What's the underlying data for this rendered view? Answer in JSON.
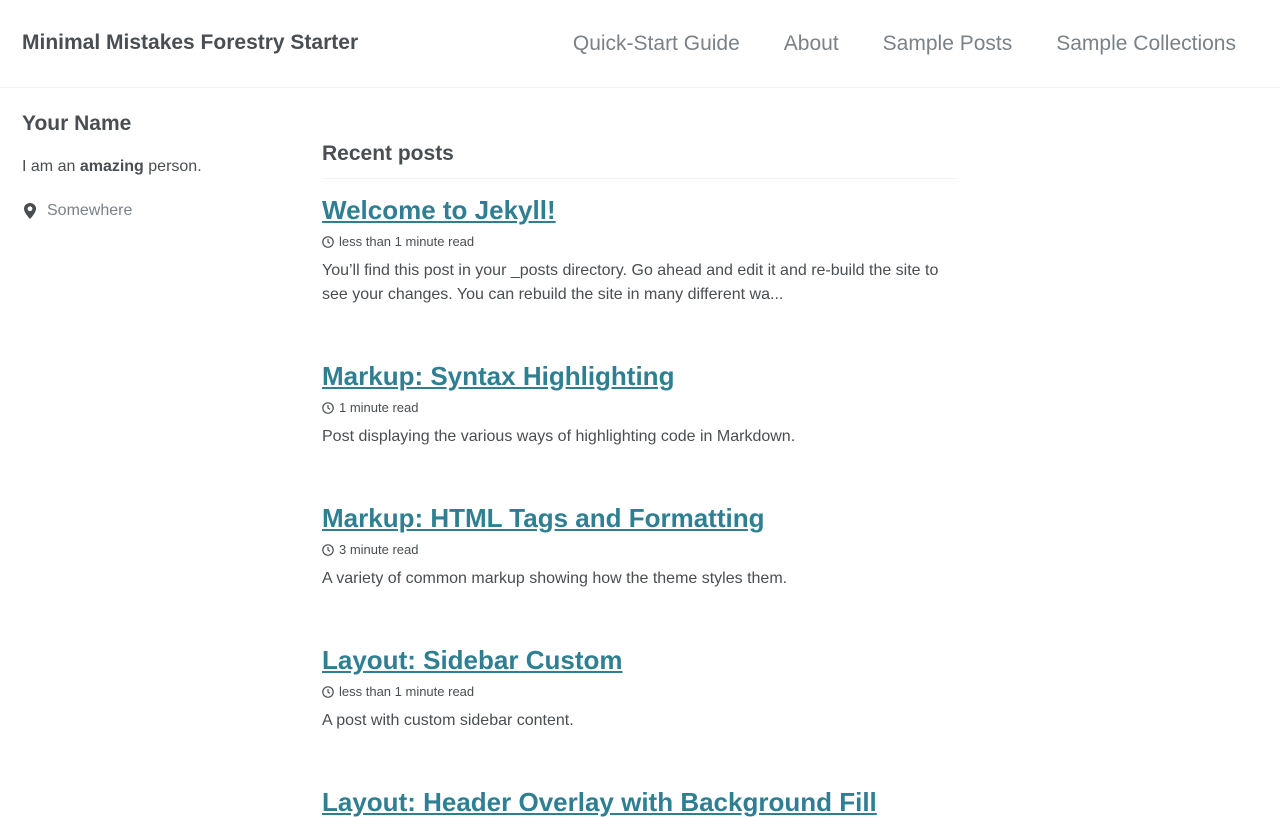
{
  "header": {
    "site_title": "Minimal Mistakes Forestry Starter",
    "nav": [
      {
        "label": "Quick-Start Guide"
      },
      {
        "label": "About"
      },
      {
        "label": "Sample Posts"
      },
      {
        "label": "Sample Collections"
      }
    ]
  },
  "sidebar": {
    "author_name": "Your Name",
    "bio_prefix": "I am an ",
    "bio_strong": "amazing",
    "bio_suffix": " person.",
    "location": "Somewhere",
    "location_icon": "map-marker-icon"
  },
  "main": {
    "section_title": "Recent posts",
    "posts": [
      {
        "title": "Welcome to Jekyll!",
        "read_time": "less than 1 minute read",
        "excerpt": "You’ll find this post in your _posts directory. Go ahead and edit it and re-build the site to see your changes. You can rebuild the site in many different wa..."
      },
      {
        "title": "Markup: Syntax Highlighting",
        "read_time": "1 minute read",
        "excerpt": "Post displaying the various ways of highlighting code in Markdown."
      },
      {
        "title": "Markup: HTML Tags and Formatting",
        "read_time": "3 minute read",
        "excerpt": "A variety of common markup showing how the theme styles them."
      },
      {
        "title": "Layout: Sidebar Custom",
        "read_time": "less than 1 minute read",
        "excerpt": "A post with custom sidebar content."
      },
      {
        "title": "Layout: Header Overlay with Background Fill",
        "read_time": "",
        "excerpt": ""
      }
    ]
  },
  "colors": {
    "link": "#2f7f93",
    "text": "#494e52",
    "nav_text": "#7a8288",
    "border": "#f2f3f3"
  }
}
